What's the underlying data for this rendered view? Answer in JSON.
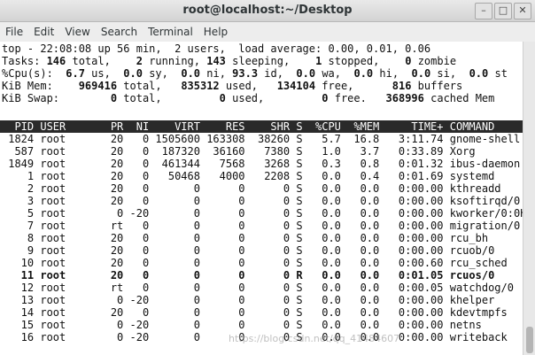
{
  "window": {
    "title": "root@localhost:~/Desktop",
    "controls": [
      "–",
      "□",
      "✕"
    ]
  },
  "menu": [
    "File",
    "Edit",
    "View",
    "Search",
    "Terminal",
    "Help"
  ],
  "summary": {
    "top_lead": "top - 22:08:08 up 56 min,  2 users,  load average: 0.00, 0.01, 0.06",
    "tasks": [
      {
        "t": "Tasks: ",
        "b": false
      },
      {
        "t": "146",
        "b": true
      },
      {
        "t": " total,    ",
        "b": false
      },
      {
        "t": "2",
        "b": true
      },
      {
        "t": " running, ",
        "b": false
      },
      {
        "t": "143",
        "b": true
      },
      {
        "t": " sleeping,    ",
        "b": false
      },
      {
        "t": "1",
        "b": true
      },
      {
        "t": " stopped,    ",
        "b": false
      },
      {
        "t": "0",
        "b": true
      },
      {
        "t": " zombie",
        "b": false
      }
    ],
    "cpu": [
      {
        "t": "%Cpu(s):  ",
        "b": false
      },
      {
        "t": "6.7",
        "b": true
      },
      {
        "t": " us,  ",
        "b": false
      },
      {
        "t": "0.0",
        "b": true
      },
      {
        "t": " sy,  ",
        "b": false
      },
      {
        "t": "0.0",
        "b": true
      },
      {
        "t": " ni, ",
        "b": false
      },
      {
        "t": "93.3",
        "b": true
      },
      {
        "t": " id,  ",
        "b": false
      },
      {
        "t": "0.0",
        "b": true
      },
      {
        "t": " wa,  ",
        "b": false
      },
      {
        "t": "0.0",
        "b": true
      },
      {
        "t": " hi,  ",
        "b": false
      },
      {
        "t": "0.0",
        "b": true
      },
      {
        "t": " si,  ",
        "b": false
      },
      {
        "t": "0.0",
        "b": true
      },
      {
        "t": " st",
        "b": false
      }
    ],
    "mem": [
      {
        "t": "KiB Mem:    ",
        "b": false
      },
      {
        "t": "969416",
        "b": true
      },
      {
        "t": " total,   ",
        "b": false
      },
      {
        "t": "835312",
        "b": true
      },
      {
        "t": " used,   ",
        "b": false
      },
      {
        "t": "134104",
        "b": true
      },
      {
        "t": " free,      ",
        "b": false
      },
      {
        "t": "816",
        "b": true
      },
      {
        "t": " buffers",
        "b": false
      }
    ],
    "swap": [
      {
        "t": "KiB Swap:        ",
        "b": false
      },
      {
        "t": "0",
        "b": true
      },
      {
        "t": " total,         ",
        "b": false
      },
      {
        "t": "0",
        "b": true
      },
      {
        "t": " used,         ",
        "b": false
      },
      {
        "t": "0",
        "b": true
      },
      {
        "t": " free.   ",
        "b": false
      },
      {
        "t": "368996",
        "b": true
      },
      {
        "t": " cached Mem",
        "b": false
      }
    ]
  },
  "columns": [
    "PID",
    "USER",
    "PR",
    "NI",
    "VIRT",
    "RES",
    "SHR",
    "S",
    "%CPU",
    "%MEM",
    "TIME+",
    "COMMAND"
  ],
  "processes": [
    {
      "pid": "1824",
      "user": "root",
      "pr": "20",
      "ni": "0",
      "virt": "1505600",
      "res": "163308",
      "shr": "38260",
      "s": "S",
      "cpu": "5.7",
      "mem": "16.8",
      "time": "3:11.74",
      "cmd": "gnome-shell",
      "bold": false
    },
    {
      "pid": "587",
      "user": "root",
      "pr": "20",
      "ni": "0",
      "virt": "187320",
      "res": "36160",
      "shr": "7380",
      "s": "S",
      "cpu": "1.0",
      "mem": "3.7",
      "time": "0:33.89",
      "cmd": "Xorg",
      "bold": false
    },
    {
      "pid": "1849",
      "user": "root",
      "pr": "20",
      "ni": "0",
      "virt": "461344",
      "res": "7568",
      "shr": "3268",
      "s": "S",
      "cpu": "0.3",
      "mem": "0.8",
      "time": "0:01.32",
      "cmd": "ibus-daemon",
      "bold": false
    },
    {
      "pid": "1",
      "user": "root",
      "pr": "20",
      "ni": "0",
      "virt": "50468",
      "res": "4000",
      "shr": "2208",
      "s": "S",
      "cpu": "0.0",
      "mem": "0.4",
      "time": "0:01.69",
      "cmd": "systemd",
      "bold": false
    },
    {
      "pid": "2",
      "user": "root",
      "pr": "20",
      "ni": "0",
      "virt": "0",
      "res": "0",
      "shr": "0",
      "s": "S",
      "cpu": "0.0",
      "mem": "0.0",
      "time": "0:00.00",
      "cmd": "kthreadd",
      "bold": false
    },
    {
      "pid": "3",
      "user": "root",
      "pr": "20",
      "ni": "0",
      "virt": "0",
      "res": "0",
      "shr": "0",
      "s": "S",
      "cpu": "0.0",
      "mem": "0.0",
      "time": "0:00.00",
      "cmd": "ksoftirqd/0",
      "bold": false
    },
    {
      "pid": "5",
      "user": "root",
      "pr": "0",
      "ni": "-20",
      "virt": "0",
      "res": "0",
      "shr": "0",
      "s": "S",
      "cpu": "0.0",
      "mem": "0.0",
      "time": "0:00.00",
      "cmd": "kworker/0:0H",
      "bold": false
    },
    {
      "pid": "7",
      "user": "root",
      "pr": "rt",
      "ni": "0",
      "virt": "0",
      "res": "0",
      "shr": "0",
      "s": "S",
      "cpu": "0.0",
      "mem": "0.0",
      "time": "0:00.00",
      "cmd": "migration/0",
      "bold": false
    },
    {
      "pid": "8",
      "user": "root",
      "pr": "20",
      "ni": "0",
      "virt": "0",
      "res": "0",
      "shr": "0",
      "s": "S",
      "cpu": "0.0",
      "mem": "0.0",
      "time": "0:00.00",
      "cmd": "rcu_bh",
      "bold": false
    },
    {
      "pid": "9",
      "user": "root",
      "pr": "20",
      "ni": "0",
      "virt": "0",
      "res": "0",
      "shr": "0",
      "s": "S",
      "cpu": "0.0",
      "mem": "0.0",
      "time": "0:00.00",
      "cmd": "rcuob/0",
      "bold": false
    },
    {
      "pid": "10",
      "user": "root",
      "pr": "20",
      "ni": "0",
      "virt": "0",
      "res": "0",
      "shr": "0",
      "s": "S",
      "cpu": "0.0",
      "mem": "0.0",
      "time": "0:00.60",
      "cmd": "rcu_sched",
      "bold": false
    },
    {
      "pid": "11",
      "user": "root",
      "pr": "20",
      "ni": "0",
      "virt": "0",
      "res": "0",
      "shr": "0",
      "s": "R",
      "cpu": "0.0",
      "mem": "0.0",
      "time": "0:01.05",
      "cmd": "rcuos/0",
      "bold": true
    },
    {
      "pid": "12",
      "user": "root",
      "pr": "rt",
      "ni": "0",
      "virt": "0",
      "res": "0",
      "shr": "0",
      "s": "S",
      "cpu": "0.0",
      "mem": "0.0",
      "time": "0:00.05",
      "cmd": "watchdog/0",
      "bold": false
    },
    {
      "pid": "13",
      "user": "root",
      "pr": "0",
      "ni": "-20",
      "virt": "0",
      "res": "0",
      "shr": "0",
      "s": "S",
      "cpu": "0.0",
      "mem": "0.0",
      "time": "0:00.00",
      "cmd": "khelper",
      "bold": false
    },
    {
      "pid": "14",
      "user": "root",
      "pr": "20",
      "ni": "0",
      "virt": "0",
      "res": "0",
      "shr": "0",
      "s": "S",
      "cpu": "0.0",
      "mem": "0.0",
      "time": "0:00.00",
      "cmd": "kdevtmpfs",
      "bold": false
    },
    {
      "pid": "15",
      "user": "root",
      "pr": "0",
      "ni": "-20",
      "virt": "0",
      "res": "0",
      "shr": "0",
      "s": "S",
      "cpu": "0.0",
      "mem": "0.0",
      "time": "0:00.00",
      "cmd": "netns",
      "bold": false
    },
    {
      "pid": "16",
      "user": "root",
      "pr": "0",
      "ni": "-20",
      "virt": "0",
      "res": "0",
      "shr": "0",
      "s": "S",
      "cpu": "0.0",
      "mem": "0.0",
      "time": "0:00.00",
      "cmd": "writeback",
      "bold": false
    }
  ],
  "watermark": "https://blog.csdn.net/qq_41484607"
}
